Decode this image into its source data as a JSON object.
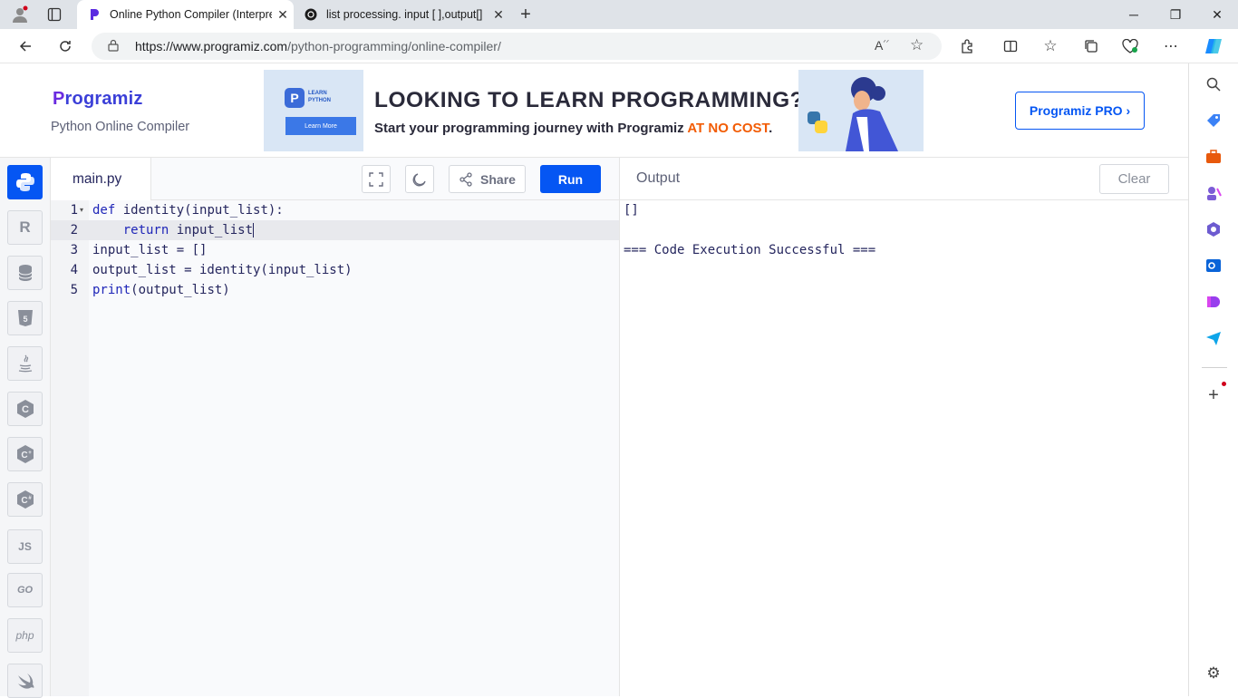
{
  "browser": {
    "tabs": [
      {
        "label": "Online Python Compiler (Interpre",
        "icon": "programiz-favicon",
        "active": true
      },
      {
        "label": "list processing. input [ ],output[]",
        "icon": "chatgpt-favicon",
        "active": false
      }
    ],
    "new_tab_symbol": "+",
    "url_domain": "https://www.programiz.com",
    "url_path": "/python-programming/online-compiler/"
  },
  "header": {
    "logo_first": "P",
    "logo_rest": "rogramiz",
    "subtitle": "Python Online Compiler",
    "pro_button": "Programiz PRO ›"
  },
  "banner": {
    "badge_line1": "LEARN",
    "badge_line2": "PYTHON",
    "learn_more": "Learn More",
    "headline": "LOOKING TO LEARN PROGRAMMING?",
    "sub_text": "Start your programming journey with Programiz ",
    "sub_highlight": "AT NO COST",
    "sub_end": "."
  },
  "languages": [
    "python",
    "r",
    "sql",
    "html",
    "java",
    "c",
    "c++",
    "c#",
    "JS",
    "GO",
    "php",
    "swift"
  ],
  "editor": {
    "filename": "main.py",
    "share_label": "Share",
    "run_label": "Run",
    "line_numbers": [
      "1",
      "2",
      "3",
      "4",
      "5"
    ],
    "lines": [
      {
        "kw": "def",
        "rest": " identity(input_list):"
      },
      {
        "kw": "    return",
        "rest": " input_list"
      },
      {
        "kw": "",
        "rest": "input_list = []"
      },
      {
        "kw": "",
        "rest": "output_list = identity(input_list)"
      },
      {
        "kw": "print",
        "rest": "(output_list)"
      }
    ]
  },
  "output": {
    "title": "Output",
    "clear_label": "Clear",
    "lines": [
      "[]",
      "",
      "=== Code Execution Successful ==="
    ]
  },
  "colors": {
    "accent": "#0556f3",
    "highlight": "#f25c05",
    "keyword": "#1f26b8"
  }
}
